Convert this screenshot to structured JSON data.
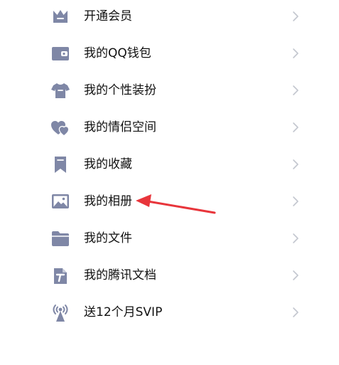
{
  "colors": {
    "icon": "#7f87a6",
    "text": "#111111",
    "chevron": "#c3c7cf",
    "annotation_arrow": "#e8353b",
    "background": "#ffffff"
  },
  "menu": {
    "items": [
      {
        "label": "开通会员",
        "icon": "crown-icon"
      },
      {
        "label": "我的QQ钱包",
        "icon": "wallet-icon"
      },
      {
        "label": "我的个性装扮",
        "icon": "shirt-icon"
      },
      {
        "label": "我的情侣空间",
        "icon": "hearts-icon"
      },
      {
        "label": "我的收藏",
        "icon": "bookmark-icon"
      },
      {
        "label": "我的相册",
        "icon": "image-icon"
      },
      {
        "label": "我的文件",
        "icon": "folder-icon"
      },
      {
        "label": "我的腾讯文档",
        "icon": "tencent-docs-icon"
      },
      {
        "label": "送12个月SVIP",
        "icon": "broadcast-tower-icon"
      }
    ]
  }
}
